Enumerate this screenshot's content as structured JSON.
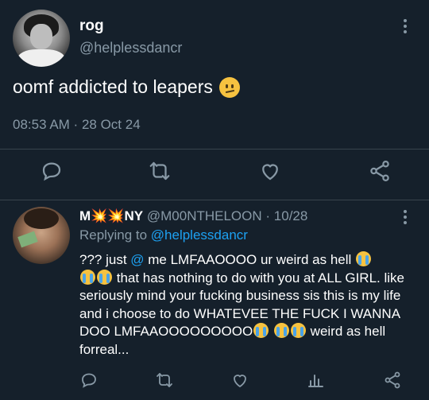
{
  "tweet": {
    "display_name": "rog",
    "handle": "@helplessdancr",
    "text": "oomf addicted to leapers",
    "text_emoji": "confused-face",
    "time": "08:53 AM",
    "separator": " · ",
    "date": "28 Oct 24"
  },
  "reply": {
    "display_name_start": "M",
    "display_name_emoji": "💥💥",
    "display_name_end": "NY",
    "handle": "@M00NTHELOON",
    "separator": " · ",
    "date": "10/28",
    "replying_prefix": "Replying to ",
    "replying_to": "@helplessdancr",
    "body_1": "??? just ",
    "body_mention": "@",
    "body_2": " me LMFAAOOOO ur weird as hell ",
    "body_3": " that has nothing to do with you at ALL GIRL. like seriously mind your fucking business sis this is my life and i choose to do WHATEVEE THE FUCK I WANNA DOO LMFAAOOOOOOOOO",
    "body_4": " weird as hell forreal..."
  },
  "colors": {
    "background": "#15202b",
    "secondary_text": "#8899a6",
    "accent": "#1da1f2",
    "divider": "#38444d"
  },
  "icons": [
    "more-icon",
    "reply-icon",
    "retweet-icon",
    "like-icon",
    "share-icon",
    "analytics-icon"
  ]
}
